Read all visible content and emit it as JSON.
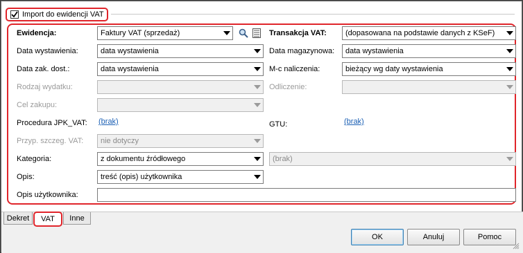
{
  "header": {
    "checkbox_label": "Import do ewidencji VAT",
    "checked": true
  },
  "left": {
    "ewidencja": {
      "label": "Ewidencja:",
      "value": "Faktury VAT (sprzedaż)"
    },
    "data_wystawienia": {
      "label": "Data wystawienia:",
      "value": "data wystawienia"
    },
    "data_zak_dost": {
      "label": "Data zak. dost.:",
      "value": "data wystawienia"
    },
    "rodzaj_wydatku": {
      "label": "Rodzaj wydatku:",
      "value": ""
    },
    "cel_zakupu": {
      "label": "Cel zakupu:",
      "value": ""
    },
    "procedura": {
      "label": "Procedura JPK_VAT:",
      "link": "(brak)"
    },
    "przyp": {
      "label": "Przyp. szczeg. VAT:",
      "value": "nie dotyczy"
    },
    "kategoria": {
      "label": "Kategoria:",
      "value": "z dokumentu źródłowego",
      "value2": "(brak)"
    },
    "opis": {
      "label": "Opis:",
      "value": "treść (opis) użytkownika"
    },
    "opis_uzytkownika": {
      "label": "Opis użytkownika:",
      "value": ""
    }
  },
  "right": {
    "transakcja": {
      "label": "Transakcja VAT:",
      "value": "(dopasowana na podstawie danych z KSeF)"
    },
    "data_magazynowa": {
      "label": "Data magazynowa:",
      "value": "data wystawienia"
    },
    "mc_naliczenia": {
      "label": "M-c naliczenia:",
      "value": "bieżący wg daty wystawienia"
    },
    "odliczenie": {
      "label": "Odliczenie:",
      "value": ""
    },
    "gtu": {
      "label": "GTU:",
      "link": "(brak)"
    }
  },
  "tabs": [
    {
      "label": "Dekret"
    },
    {
      "label": "VAT"
    },
    {
      "label": "Inne"
    }
  ],
  "buttons": {
    "ok": "OK",
    "cancel": "Anuluj",
    "help": "Pomoc"
  },
  "icons": {
    "search": "magnifier-icon",
    "list": "list-icon",
    "dropdown": "chevron-down-icon"
  },
  "colors": {
    "highlight": "#e0242a",
    "link": "#1a5fb4"
  }
}
